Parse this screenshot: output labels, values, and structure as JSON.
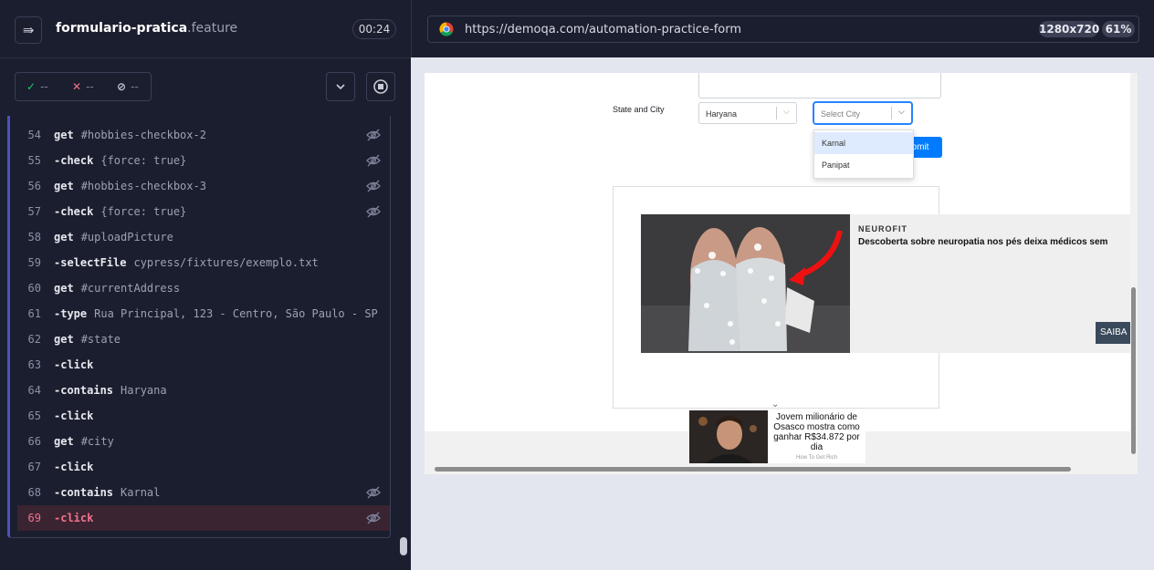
{
  "runner": {
    "file_name": "formulario-pratica",
    "file_ext": ".feature",
    "timer": "00:24",
    "stats": {
      "passed": {
        "icon": "✓",
        "value": "--",
        "color": "#1fc16b"
      },
      "failed": {
        "icon": "✕",
        "value": "--",
        "color": "#f4728a"
      },
      "pending": {
        "icon": "⊘",
        "value": "--",
        "color": "#c9cbd6"
      }
    },
    "commands": [
      {
        "line": "54",
        "name": "get",
        "arg": "#hobbies-checkbox-2",
        "child": false,
        "hidden": true
      },
      {
        "line": "55",
        "name": "-check",
        "arg": "{force: true}",
        "child": true,
        "hidden": true
      },
      {
        "line": "56",
        "name": "get",
        "arg": "#hobbies-checkbox-3",
        "child": false,
        "hidden": true
      },
      {
        "line": "57",
        "name": "-check",
        "arg": "{force: true}",
        "child": true,
        "hidden": true
      },
      {
        "line": "58",
        "name": "get",
        "arg": "#uploadPicture",
        "child": false,
        "hidden": false
      },
      {
        "line": "59",
        "name": "-selectFile",
        "arg": "cypress/fixtures/exemplo.txt",
        "child": true,
        "hidden": false
      },
      {
        "line": "60",
        "name": "get",
        "arg": "#currentAddress",
        "child": false,
        "hidden": false
      },
      {
        "line": "61",
        "name": "-type",
        "arg": "Rua Principal, 123 - Centro, São Paulo - SP",
        "child": true,
        "hidden": false
      },
      {
        "line": "62",
        "name": "get",
        "arg": "#state",
        "child": false,
        "hidden": false
      },
      {
        "line": "63",
        "name": "-click",
        "arg": "",
        "child": true,
        "hidden": false
      },
      {
        "line": "64",
        "name": "-contains",
        "arg": "Haryana",
        "child": true,
        "hidden": false
      },
      {
        "line": "65",
        "name": "-click",
        "arg": "",
        "child": true,
        "hidden": false
      },
      {
        "line": "66",
        "name": "get",
        "arg": "#city",
        "child": false,
        "hidden": false
      },
      {
        "line": "67",
        "name": "-click",
        "arg": "",
        "child": true,
        "hidden": false
      },
      {
        "line": "68",
        "name": "-contains",
        "arg": "Karnal",
        "child": true,
        "hidden": true
      },
      {
        "line": "69",
        "name": "-click",
        "arg": "",
        "child": true,
        "hidden": true,
        "failed": true
      }
    ]
  },
  "browser": {
    "url": "https://demoqa.com/automation-practice-form",
    "viewport": "1280x720",
    "zoom": "61%"
  },
  "form": {
    "state_city_label": "State and City",
    "state_value": "Haryana",
    "city_placeholder": "Select City",
    "city_options": [
      "Karnal",
      "Panipat"
    ],
    "submit_label": "Submit",
    "submit_visible": "ubmit"
  },
  "ad": {
    "brand": "NEUROFIT",
    "headline": "Descoberta sobre neuropatia nos pés deixa médicos sem",
    "cta": "SAIBA",
    "card_text": "Jovem milionário de Osasco mostra como ganhar R$34.872 por dia",
    "card_source": "How To Get Rich"
  }
}
